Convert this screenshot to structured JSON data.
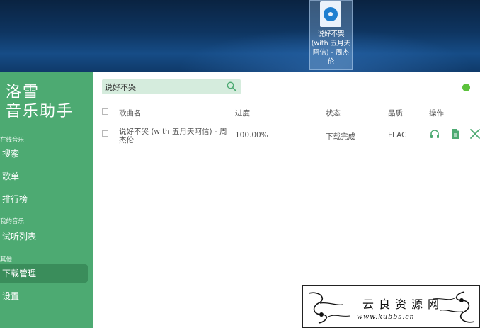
{
  "desktop": {
    "file_icon": {
      "icon": "music-file-icon",
      "label_lines": [
        "说好不哭",
        "(with 五月天",
        "阿信) - 周杰",
        "伦"
      ]
    }
  },
  "sidebar": {
    "app_title_lines": [
      "洛雪",
      "音乐助手"
    ],
    "sections": [
      {
        "label": "在线音乐",
        "items": [
          {
            "label": "搜索"
          },
          {
            "label": "歌单"
          },
          {
            "label": "排行榜"
          }
        ]
      },
      {
        "label": "我的音乐",
        "items": [
          {
            "label": "试听列表"
          }
        ]
      },
      {
        "label": "其他",
        "items": [
          {
            "label": "下载管理",
            "active": true
          },
          {
            "label": "设置"
          }
        ]
      }
    ]
  },
  "search": {
    "value": "说好不哭",
    "icon": "search-icon"
  },
  "status": {
    "color": "#5cc23c"
  },
  "table": {
    "headers": {
      "name": "歌曲名",
      "progress": "进度",
      "status": "状态",
      "quality": "品质",
      "actions": "操作"
    },
    "rows": [
      {
        "name": "说好不哭 (with 五月天阿信) - 周杰伦",
        "progress": "100.00%",
        "status": "下载完成",
        "quality": "FLAC",
        "actions": [
          "headphones-icon",
          "file-icon",
          "close-icon"
        ]
      }
    ]
  },
  "watermark": {
    "title": "云良资源网",
    "url": "www.kubbs.cn"
  },
  "colors": {
    "sidebar": "#4daa72",
    "accent": "#4daa72",
    "search_bg": "#d5ecdd",
    "desktop": "#0e3561"
  }
}
